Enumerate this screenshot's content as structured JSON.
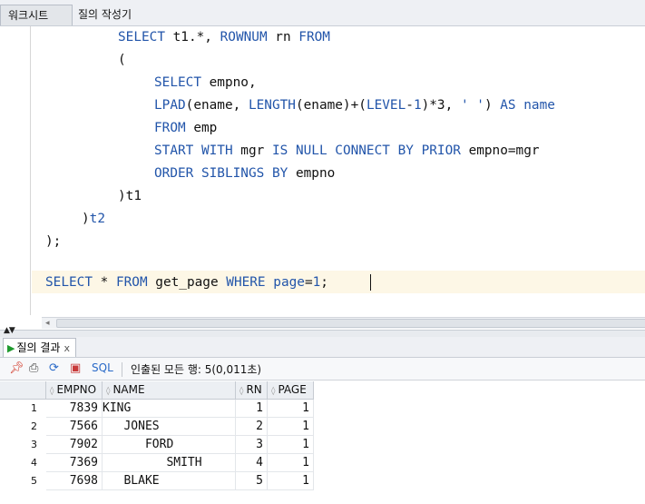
{
  "tabs": {
    "worksheet": "워크시트",
    "query_builder": "질의 작성기"
  },
  "editor": {
    "lines": [
      [
        {
          "t": "SELECT",
          "k": 1
        },
        {
          "t": " t1.*, ",
          "k": 0
        },
        {
          "t": "ROWNUM",
          "k": 1
        },
        {
          "t": " rn ",
          "k": 0
        },
        {
          "t": "FROM",
          "k": 1
        }
      ],
      [
        {
          "t": "(",
          "k": 0
        }
      ],
      [
        {
          "t": "SELECT",
          "k": 1
        },
        {
          "t": " empno,",
          "k": 0
        }
      ],
      [
        {
          "t": "LPAD",
          "k": 1
        },
        {
          "t": "(ename, ",
          "k": 0
        },
        {
          "t": "LENGTH",
          "k": 1
        },
        {
          "t": "(ename)+(",
          "k": 0
        },
        {
          "t": "LEVEL",
          "k": 1
        },
        {
          "t": "-",
          "k": 0
        },
        {
          "t": "1",
          "k": 1
        },
        {
          "t": ")*3, ",
          "k": 0
        },
        {
          "t": "' '",
          "k": 1
        },
        {
          "t": ") ",
          "k": 0
        },
        {
          "t": "AS",
          "k": 1
        },
        {
          "t": " ",
          "k": 0
        },
        {
          "t": "name",
          "k": 1
        }
      ],
      [
        {
          "t": "FROM",
          "k": 1
        },
        {
          "t": " emp",
          "k": 0
        }
      ],
      [
        {
          "t": "START WITH",
          "k": 1
        },
        {
          "t": " mgr ",
          "k": 0
        },
        {
          "t": "IS NULL CONNECT BY PRIOR",
          "k": 1
        },
        {
          "t": " empno=mgr",
          "k": 0
        }
      ],
      [
        {
          "t": "ORDER SIBLINGS BY",
          "k": 1
        },
        {
          "t": " empno",
          "k": 0
        }
      ],
      [
        {
          "t": ")t1",
          "k": 0
        }
      ],
      [
        {
          "t": ")",
          "k": 0
        },
        {
          "t": "t2",
          "k": 1
        }
      ],
      [
        {
          "t": ");",
          "k": 0
        }
      ],
      [],
      [
        {
          "t": "SELECT",
          "k": 1
        },
        {
          "t": " * ",
          "k": 0
        },
        {
          "t": "FROM",
          "k": 1
        },
        {
          "t": " get_page ",
          "k": 0
        },
        {
          "t": "WHERE",
          "k": 1
        },
        {
          "t": " ",
          "k": 0
        },
        {
          "t": "page",
          "k": 1
        },
        {
          "t": "=",
          "k": 0
        },
        {
          "t": "1",
          "k": 1
        },
        {
          "t": ";",
          "k": 0
        }
      ]
    ]
  },
  "results_tab": {
    "label": "질의 결과",
    "close": "x"
  },
  "toolbar": {
    "sql_label": "SQL",
    "status": "인출된 모든 행: 5(0,011초)"
  },
  "grid": {
    "columns": [
      "EMPNO",
      "NAME",
      "RN",
      "PAGE"
    ],
    "rows": [
      {
        "n": "1",
        "empno": "7839",
        "name": "KING",
        "rn": "1",
        "page": "1"
      },
      {
        "n": "2",
        "empno": "7566",
        "name": "   JONES",
        "rn": "2",
        "page": "1"
      },
      {
        "n": "3",
        "empno": "7902",
        "name": "      FORD",
        "rn": "3",
        "page": "1"
      },
      {
        "n": "4",
        "empno": "7369",
        "name": "         SMITH",
        "rn": "4",
        "page": "1"
      },
      {
        "n": "5",
        "empno": "7698",
        "name": "   BLAKE",
        "rn": "5",
        "page": "1"
      }
    ]
  },
  "colors": {
    "keyword": "#2255aa",
    "current_line": "#fdf7e6",
    "run_icon": "#1f9a2e"
  },
  "icons": [
    "run-icon",
    "pin-icon",
    "print-icon",
    "refresh-icon",
    "export-icon"
  ]
}
